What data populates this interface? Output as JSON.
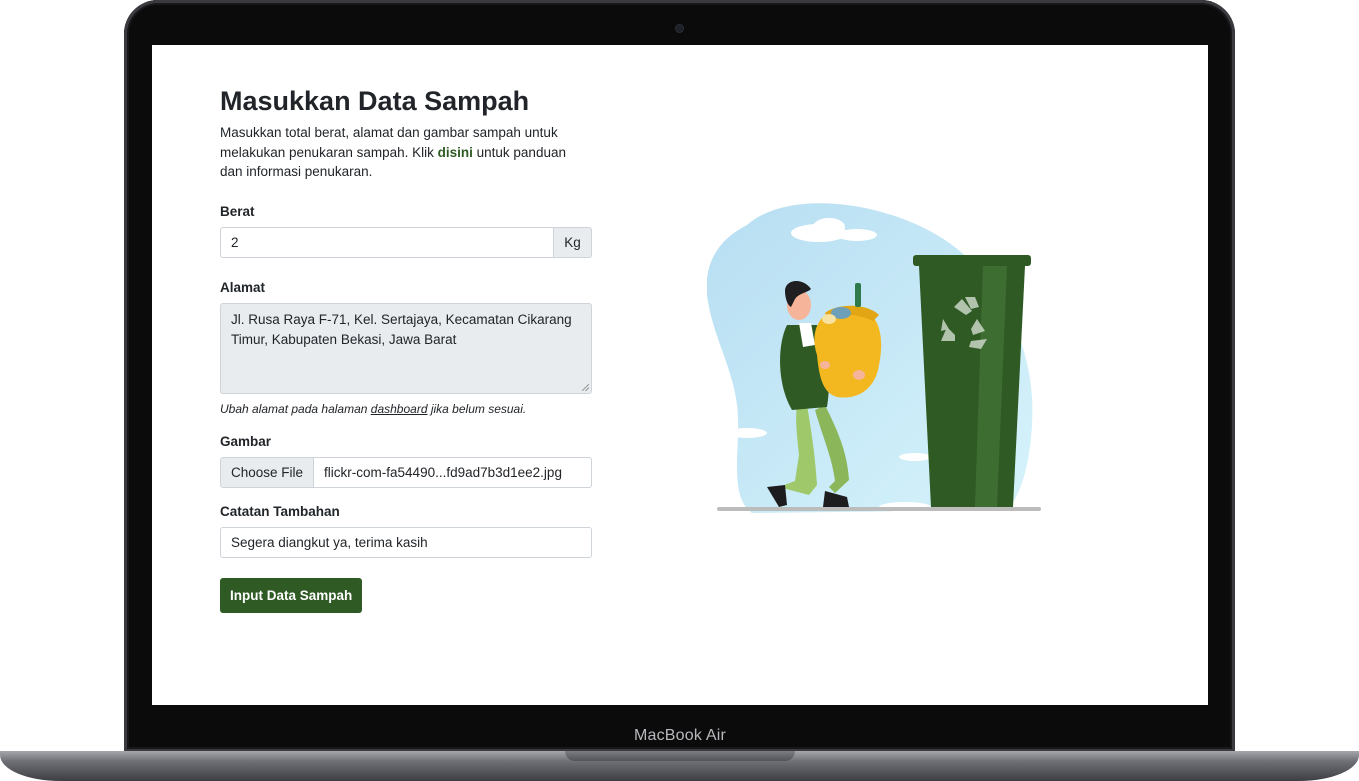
{
  "device": {
    "label": "MacBook Air"
  },
  "page": {
    "title": "Masukkan Data Sampah",
    "intro_before": "Masukkan total berat, alamat dan gambar sampah untuk melakukan penukaran sampah. Klik ",
    "intro_link": "disini",
    "intro_after": " untuk panduan dan informasi penukaran."
  },
  "form": {
    "weight": {
      "label": "Berat",
      "value": "2",
      "unit": "Kg"
    },
    "address": {
      "label": "Alamat",
      "value": "Jl. Rusa Raya F-71, Kel. Sertajaya, Kecamatan Cikarang Timur, Kabupaten Bekasi, Jawa Barat",
      "hint_before": "Ubah alamat pada halaman ",
      "hint_link": "dashboard",
      "hint_after": " jika belum sesuai."
    },
    "image": {
      "label": "Gambar",
      "button": "Choose File",
      "filename": "flickr-com-fa54490...fd9ad7b3d1ee2.jpg"
    },
    "notes": {
      "label": "Catatan Tambahan",
      "value": "Segera diangkut ya, terima kasih"
    },
    "submit_label": "Input Data Sampah"
  },
  "colors": {
    "accent": "#2f5a24",
    "bin": "#2f5a24",
    "blob": "#cdeefa",
    "bag": "#f3b81f"
  }
}
